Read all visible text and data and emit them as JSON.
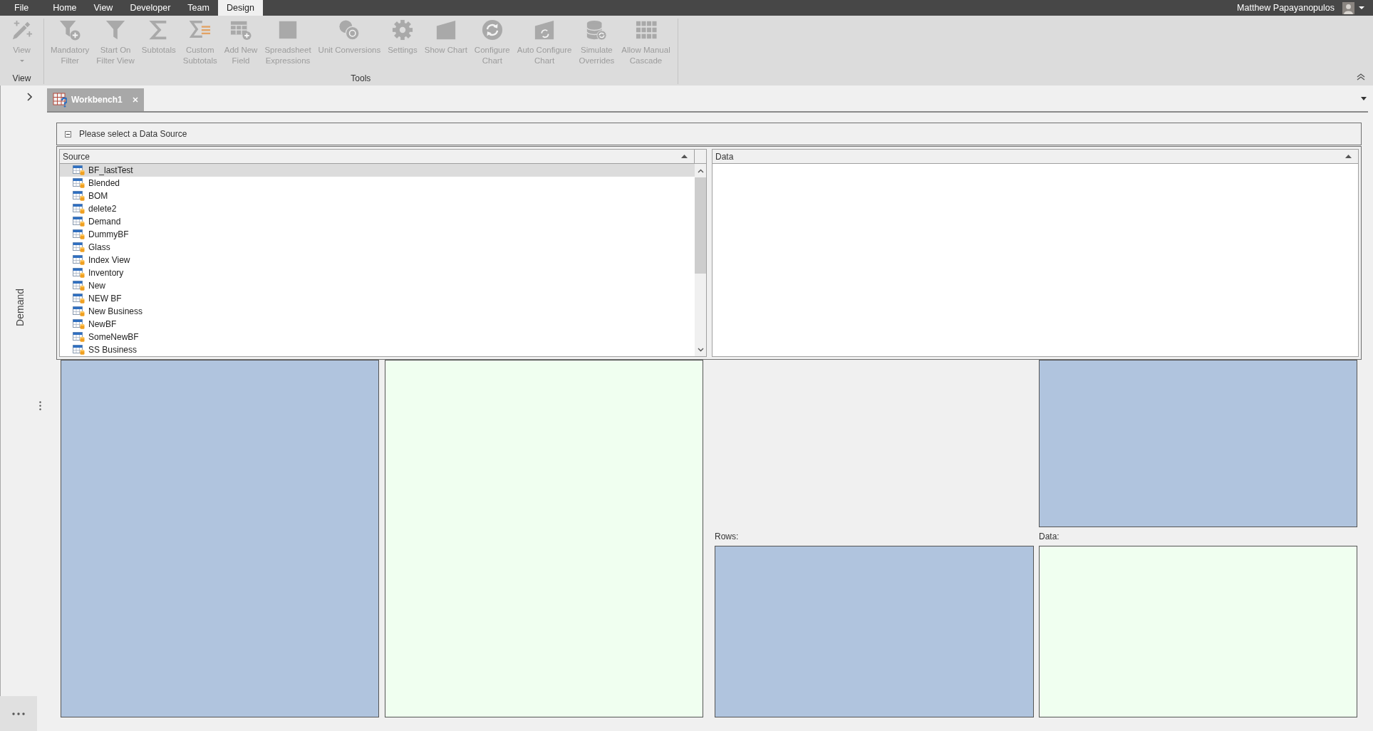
{
  "menu_bar": {
    "tabs": [
      {
        "label": "File",
        "selected": false
      },
      {
        "label": "Home",
        "selected": false
      },
      {
        "label": "View",
        "selected": false
      },
      {
        "label": "Developer",
        "selected": false
      },
      {
        "label": "Team",
        "selected": false
      },
      {
        "label": "Design",
        "selected": true
      }
    ],
    "user_name": "Matthew Papayanopulos"
  },
  "ribbon": {
    "groups": [
      {
        "label": "View",
        "buttons": [
          {
            "kind": "view",
            "label": "View",
            "dropdown": true,
            "disabled": true
          }
        ]
      },
      {
        "label": "Tools",
        "buttons": [
          {
            "kind": "mandatory",
            "label": "Mandatory\nFilter",
            "dropdown": false,
            "disabled": true
          },
          {
            "kind": "filter",
            "label": "Start On\nFilter View",
            "dropdown": false,
            "disabled": true
          },
          {
            "kind": "subtotal",
            "label": "Subtotals",
            "dropdown": false,
            "disabled": true
          },
          {
            "kind": "custom",
            "label": "Custom\nSubtotals",
            "dropdown": false,
            "disabled": true
          },
          {
            "kind": "addfield",
            "label": "Add New\nField",
            "dropdown": false,
            "disabled": true
          },
          {
            "kind": "expression",
            "label": "Spreadsheet\nExpressions",
            "dropdown": false,
            "disabled": true
          },
          {
            "kind": "conversion",
            "label": "Unit Conversions",
            "dropdown": false,
            "disabled": true
          },
          {
            "kind": "settings",
            "label": "Settings",
            "dropdown": false,
            "disabled": true
          },
          {
            "kind": "chart",
            "label": "Show Chart",
            "dropdown": false,
            "disabled": true
          },
          {
            "kind": "configure",
            "label": "Configure\nChart",
            "dropdown": false,
            "disabled": true
          },
          {
            "kind": "autoconfigure",
            "label": "Auto Configure\nChart",
            "dropdown": false,
            "disabled": true
          },
          {
            "kind": "simulate",
            "label": "Simulate\nOverrides",
            "dropdown": false,
            "disabled": true
          },
          {
            "kind": "cascade",
            "label": "Allow Manual\nCascade",
            "dropdown": false,
            "disabled": true
          }
        ]
      }
    ]
  },
  "document_tabs": [
    {
      "label": "Workbench1",
      "selected": true
    }
  ],
  "sidebar": {
    "label": "Demand"
  },
  "data_source_panel": {
    "title": "Please select a Data Source",
    "expanded": true,
    "source_list": {
      "column": "Source",
      "items": [
        {
          "label": "BF_lastTest",
          "selected": true
        },
        {
          "label": "Blended",
          "selected": false
        },
        {
          "label": "BOM",
          "selected": false
        },
        {
          "label": "delete2",
          "selected": false
        },
        {
          "label": "Demand",
          "selected": false
        },
        {
          "label": "DummyBF",
          "selected": false
        },
        {
          "label": "Glass",
          "selected": false
        },
        {
          "label": "Index View",
          "selected": false
        },
        {
          "label": "Inventory",
          "selected": false
        },
        {
          "label": "New",
          "selected": false
        },
        {
          "label": "NEW BF",
          "selected": false
        },
        {
          "label": "New Business",
          "selected": false
        },
        {
          "label": "NewBF",
          "selected": false
        },
        {
          "label": "SomeNewBF",
          "selected": false
        },
        {
          "label": "SS Business",
          "selected": false
        }
      ]
    },
    "data_list": {
      "column": "Data"
    }
  },
  "pivot": {
    "left_zones": [
      {
        "kind": "dimension"
      },
      {
        "kind": "measure"
      }
    ],
    "corner_zone": {
      "kind": "dimension"
    },
    "labeled_zones": [
      {
        "label": "Rows:",
        "kind": "dimension"
      },
      {
        "label": "Data:",
        "kind": "measure"
      }
    ]
  }
}
